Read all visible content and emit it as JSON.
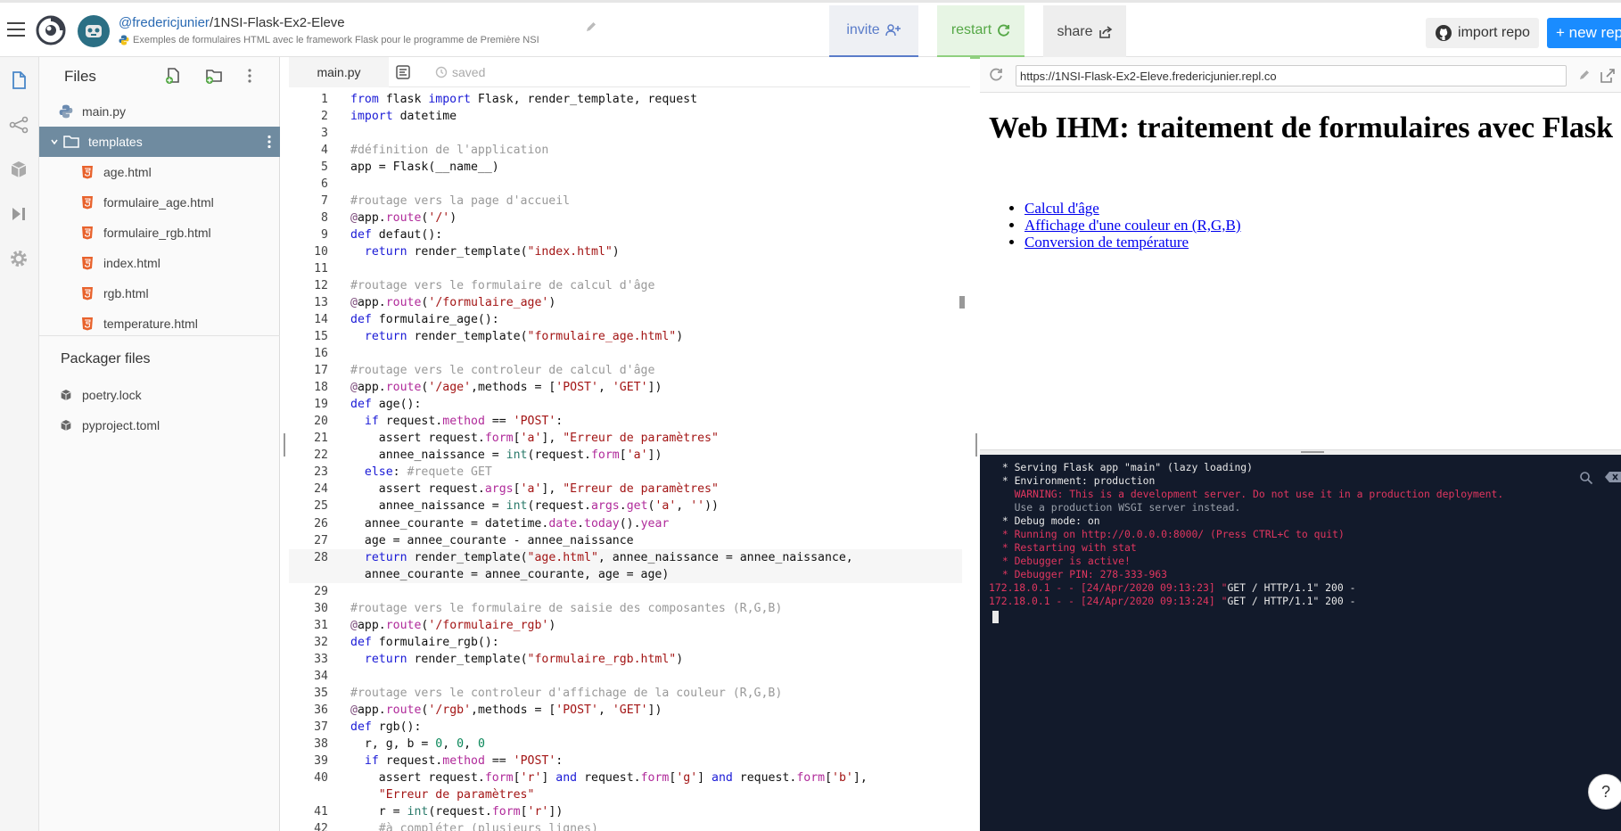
{
  "header": {
    "repl_user": "@fredericjunier",
    "repl_separator": "/",
    "repl_name": "1NSI-Flask-Ex2-Eleve",
    "repl_description": "Exemples de formulaires HTML avec le framework Flask pour le programme de Première NSI",
    "invite_label": "invite",
    "restart_label": "restart",
    "share_label": "share",
    "import_label": "import repo",
    "new_repl_label": "+ new repl"
  },
  "files": {
    "title": "Files",
    "items": [
      {
        "name": "main.py",
        "type": "python"
      },
      {
        "name": "templates",
        "type": "folder"
      },
      {
        "name": "age.html",
        "type": "html"
      },
      {
        "name": "formulaire_age.html",
        "type": "html"
      },
      {
        "name": "formulaire_rgb.html",
        "type": "html"
      },
      {
        "name": "index.html",
        "type": "html"
      },
      {
        "name": "rgb.html",
        "type": "html"
      },
      {
        "name": "temperature.html",
        "type": "html"
      }
    ],
    "packager_title": "Packager files",
    "packager_items": [
      "poetry.lock",
      "pyproject.toml"
    ]
  },
  "editor": {
    "tab_label": "main.py",
    "status": "saved",
    "lines": [
      {
        "n": "1",
        "t": "from flask import Flask, render_template, request"
      },
      {
        "n": "2",
        "t": "import datetime"
      },
      {
        "n": "3",
        "t": ""
      },
      {
        "n": "4",
        "t": "#définition de l'application"
      },
      {
        "n": "5",
        "t": "app = Flask(__name__)"
      },
      {
        "n": "6",
        "t": ""
      },
      {
        "n": "7",
        "t": "#routage vers la page d'accueil"
      },
      {
        "n": "8",
        "t": "@app.route('/')"
      },
      {
        "n": "9",
        "t": "def defaut():"
      },
      {
        "n": "10",
        "t": "  return render_template(\"index.html\")"
      },
      {
        "n": "11",
        "t": ""
      },
      {
        "n": "12",
        "t": "#routage vers le formulaire de calcul d'âge"
      },
      {
        "n": "13",
        "t": "@app.route('/formulaire_age')"
      },
      {
        "n": "14",
        "t": "def formulaire_age():"
      },
      {
        "n": "15",
        "t": "  return render_template(\"formulaire_age.html\")"
      },
      {
        "n": "16",
        "t": ""
      },
      {
        "n": "17",
        "t": "#routage vers le controleur de calcul d'âge"
      },
      {
        "n": "18",
        "t": "@app.route('/age',methods = ['POST', 'GET'])"
      },
      {
        "n": "19",
        "t": "def age():"
      },
      {
        "n": "20",
        "t": "  if request.method == 'POST':"
      },
      {
        "n": "21",
        "t": "    assert request.form['a'], \"Erreur de paramètres\""
      },
      {
        "n": "22",
        "t": "    annee_naissance = int(request.form['a'])"
      },
      {
        "n": "23",
        "t": "  else: #requete GET"
      },
      {
        "n": "24",
        "t": "    assert request.args['a'], \"Erreur de paramètres\""
      },
      {
        "n": "25",
        "t": "    annee_naissance = int(request.args.get('a', ''))"
      },
      {
        "n": "26",
        "t": "  annee_courante = datetime.date.today().year"
      },
      {
        "n": "27",
        "t": "  age = annee_courante - annee_naissance"
      },
      {
        "n": "28",
        "t": "  return render_template(\"age.html\", annee_naissance = annee_naissance,"
      },
      {
        "n": "",
        "t": "  annee_courante = annee_courante, age = age)"
      },
      {
        "n": "29",
        "t": ""
      },
      {
        "n": "30",
        "t": "#routage vers le formulaire de saisie des composantes (R,G,B)"
      },
      {
        "n": "31",
        "t": "@app.route('/formulaire_rgb')"
      },
      {
        "n": "32",
        "t": "def formulaire_rgb():"
      },
      {
        "n": "33",
        "t": "  return render_template(\"formulaire_rgb.html\")"
      },
      {
        "n": "34",
        "t": ""
      },
      {
        "n": "35",
        "t": "#routage vers le controleur d'affichage de la couleur (R,G,B)"
      },
      {
        "n": "36",
        "t": "@app.route('/rgb',methods = ['POST', 'GET'])"
      },
      {
        "n": "37",
        "t": "def rgb():"
      },
      {
        "n": "38",
        "t": "  r, g, b = 0, 0, 0"
      },
      {
        "n": "39",
        "t": "  if request.method == 'POST':"
      },
      {
        "n": "40",
        "t": "    assert request.form['r'] and request.form['g'] and request.form['b'],"
      },
      {
        "n": "",
        "t": "    \"Erreur de paramètres\""
      },
      {
        "n": "41",
        "t": "    r = int(request.form['r'])"
      },
      {
        "n": "42",
        "t": "    #à compléter (plusieurs lignes)"
      }
    ]
  },
  "browser": {
    "url": "https://1NSI-Flask-Ex2-Eleve.fredericjunier.repl.co",
    "page_title": "Web IHM: traitement de formulaires avec Flask",
    "links": [
      "Calcul d'âge",
      "Affichage d'une couleur en (R,G,B)",
      "Conversion de température"
    ]
  },
  "console": {
    "lines": [
      {
        "t": " * Serving Flask app \"main\" (lazy loading)",
        "c": ""
      },
      {
        "t": " * Environment: production",
        "c": ""
      },
      {
        "t": "   WARNING: This is a development server. Do not use it in a production deployment.",
        "c": "red"
      },
      {
        "t": "   Use a production WSGI server instead.",
        "c": "dim"
      },
      {
        "t": " * Debug mode: on",
        "c": ""
      },
      {
        "t": " * Running on http://0.0.0.0:8000/ (Press CTRL+C to quit)",
        "c": "red"
      },
      {
        "t": " * Restarting with stat",
        "c": "red"
      },
      {
        "t": " * Debugger is active!",
        "c": "red"
      },
      {
        "t": " * Debugger PIN: 278-333-963",
        "c": "red"
      }
    ],
    "log": [
      {
        "prefix": "172.18.0.1 - - [24/Apr/2020 09:13:23] \"",
        "req": "GET / HTTP/1.1\" 200 -"
      },
      {
        "prefix": "172.18.0.1 - - [24/Apr/2020 09:13:24] \"",
        "req": "GET / HTTP/1.1\" 200 -"
      }
    ]
  },
  "help_label": "?"
}
